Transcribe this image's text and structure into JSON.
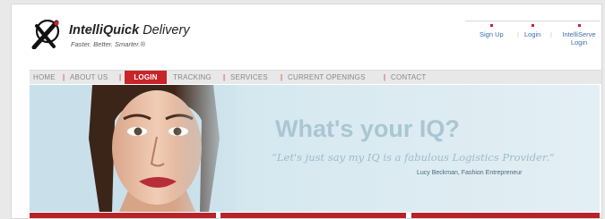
{
  "brand": {
    "name_bold": "IntelliQuick",
    "name_light": "Delivery",
    "tagline": "Faster. Better. Smarter.®",
    "colors": {
      "accent": "#c8242a",
      "link": "#3b6ea8",
      "hero": "#d7e9f0"
    }
  },
  "utility_nav": {
    "sign_up": "Sign Up",
    "login": "Login",
    "intelliserve_line1": "IntelliServe",
    "intelliserve_line2": "Login"
  },
  "main_nav": {
    "items": [
      "HOME",
      "ABOUT US",
      "LOGIN",
      "TRACKING",
      "SERVICES",
      "CURRENT OPENINGS",
      "CONTACT"
    ],
    "active": "LOGIN"
  },
  "hero": {
    "headline": "What's your IQ?",
    "quote": "“Let's just say my IQ is a fabulous Logistics Provider.”",
    "attribution": "Lucy Beckman, Fashion Entrepreneur"
  },
  "icons": [
    "logo-mark-icon"
  ]
}
